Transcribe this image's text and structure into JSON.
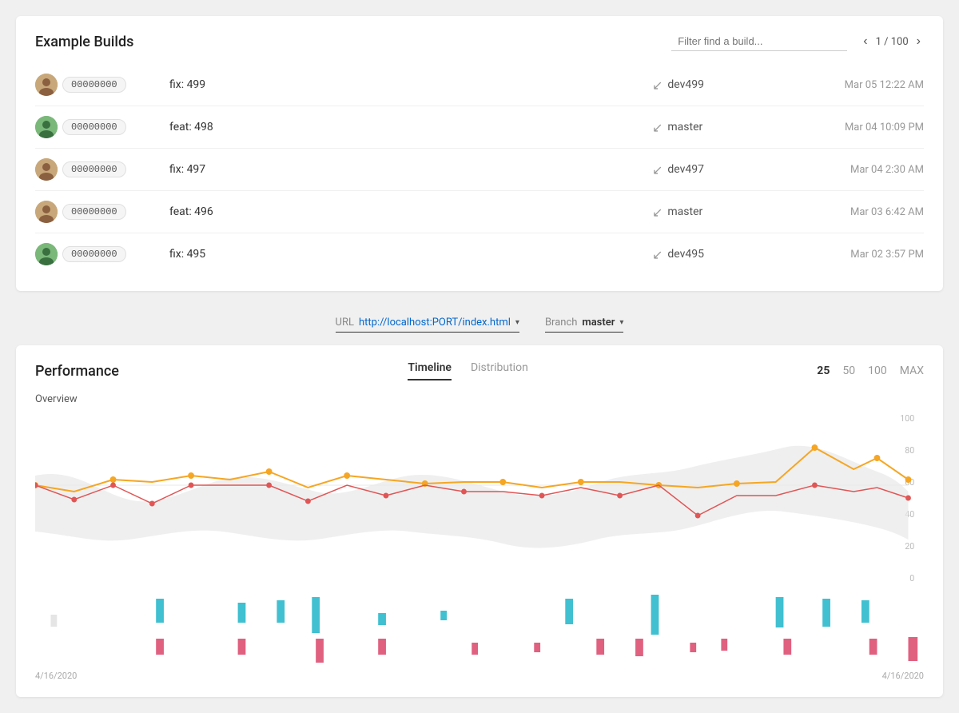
{
  "page": {
    "title": "Example Builds"
  },
  "filter": {
    "placeholder": "Filter find a build..."
  },
  "pagination": {
    "current": "1",
    "total": "100",
    "display": "1 / 100"
  },
  "builds": [
    {
      "id": "00000000",
      "label": "fix: 499",
      "branch": "dev499",
      "date": "Mar 05 12:22 AM",
      "avatar_type": "1"
    },
    {
      "id": "00000000",
      "label": "feat: 498",
      "branch": "master",
      "date": "Mar 04 10:09 PM",
      "avatar_type": "2"
    },
    {
      "id": "00000000",
      "label": "fix: 497",
      "branch": "dev497",
      "date": "Mar 04 2:30 AM",
      "avatar_type": "1"
    },
    {
      "id": "00000000",
      "label": "feat: 496",
      "branch": "master",
      "date": "Mar 03 6:42 AM",
      "avatar_type": "1"
    },
    {
      "id": "00000000",
      "label": "fix: 495",
      "branch": "dev495",
      "date": "Mar 02 3:57 PM",
      "avatar_type": "2"
    }
  ],
  "url_selector": {
    "label": "URL",
    "value": "http://localhost:PORT/index.html"
  },
  "branch_selector": {
    "label": "Branch",
    "value": "master"
  },
  "performance": {
    "title": "Performance",
    "tabs": [
      "Timeline",
      "Distribution"
    ],
    "active_tab": "Timeline",
    "counts": [
      "25",
      "50",
      "100",
      "MAX"
    ],
    "active_count": "25",
    "overview_label": "Overview",
    "y_labels": [
      "100",
      "80",
      "60",
      "40",
      "20",
      "0"
    ],
    "date_start": "4/16/2020",
    "date_end": "4/16/2020"
  }
}
